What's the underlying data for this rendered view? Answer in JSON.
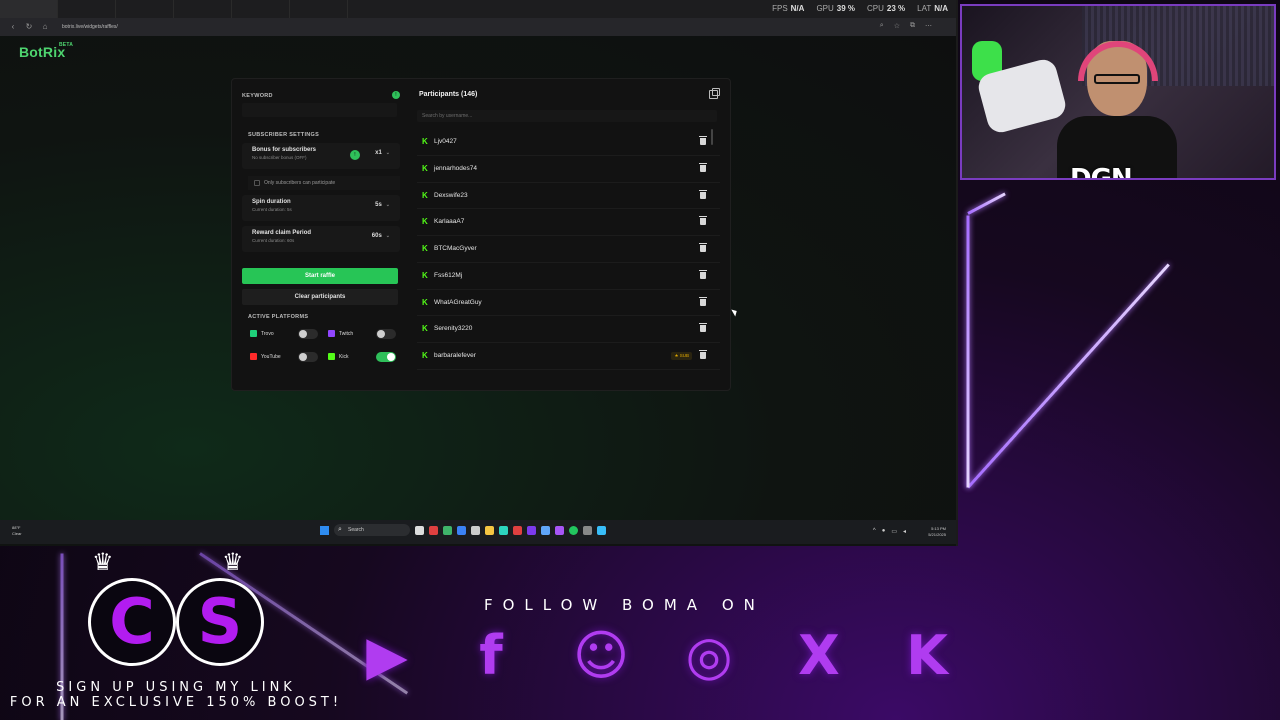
{
  "browser": {
    "url": "botrix.live/widgets/raffles/",
    "tabs": [
      "",
      "",
      "",
      "",
      "",
      ""
    ],
    "perf": [
      {
        "label": "FPS",
        "value": "N/A"
      },
      {
        "label": "GPU",
        "value": "39 %"
      },
      {
        "label": "CPU",
        "value": "23 %"
      },
      {
        "label": "LAT",
        "value": "N/A"
      }
    ]
  },
  "app": {
    "logo": "BotRix",
    "logo_badge": "BETA"
  },
  "raffle": {
    "keyword_label": "KEYWORD",
    "subscriber_settings_label": "SUBSCRIBER SETTINGS",
    "bonus_title": "Bonus for subscribers",
    "bonus_sub": "No subscriber bonus (OFF)",
    "bonus_value": "x1",
    "only_subs_label": "Only subscribers can participate",
    "spin_title": "Spin duration",
    "spin_sub": "Current duration: 5s",
    "spin_value": "5s",
    "claim_title": "Reward claim Period",
    "claim_sub": "Current duration: 60s",
    "claim_value": "60s",
    "start_button": "Start raffle",
    "clear_button": "Clear participants",
    "active_platforms_label": "ACTIVE PLATFORMS",
    "platforms": [
      {
        "name": "Trovo",
        "color": "#1fd07a",
        "on": false
      },
      {
        "name": "Twitch",
        "color": "#9146ff",
        "on": false
      },
      {
        "name": "YouTube",
        "color": "#ff2a2a",
        "on": false
      },
      {
        "name": "Kick",
        "color": "#53fc18",
        "on": true
      }
    ]
  },
  "participants": {
    "title": "Participants (146)",
    "search_placeholder": "Search by username...",
    "sub_badge": "SUB",
    "list": [
      {
        "name": "Ljv0427",
        "sub": false
      },
      {
        "name": "jennarhodes74",
        "sub": false
      },
      {
        "name": "Dexswife23",
        "sub": false
      },
      {
        "name": "KarlaaaA7",
        "sub": false
      },
      {
        "name": "BTCMacGyver",
        "sub": false
      },
      {
        "name": "Fss612Mj",
        "sub": false
      },
      {
        "name": "WhatAGreatGuy",
        "sub": false
      },
      {
        "name": "Serenity3220",
        "sub": false
      },
      {
        "name": "barbaralefever",
        "sub": true
      }
    ]
  },
  "taskbar": {
    "weather_temp": "88°F",
    "weather_desc": "Clear",
    "search": "Search",
    "time": "5:13 PM",
    "date": "5/21/2025"
  },
  "overlay": {
    "webcam_tag": "DGN",
    "follow_text": "FOLLOW BOMA ON",
    "signup_line1": "SIGN UP USING MY LINK",
    "signup_line2": "FOR AN EXCLUSIVE 150% BOOST!",
    "cs_left": "C",
    "cs_right": "S",
    "accent": "#b21cf0"
  }
}
